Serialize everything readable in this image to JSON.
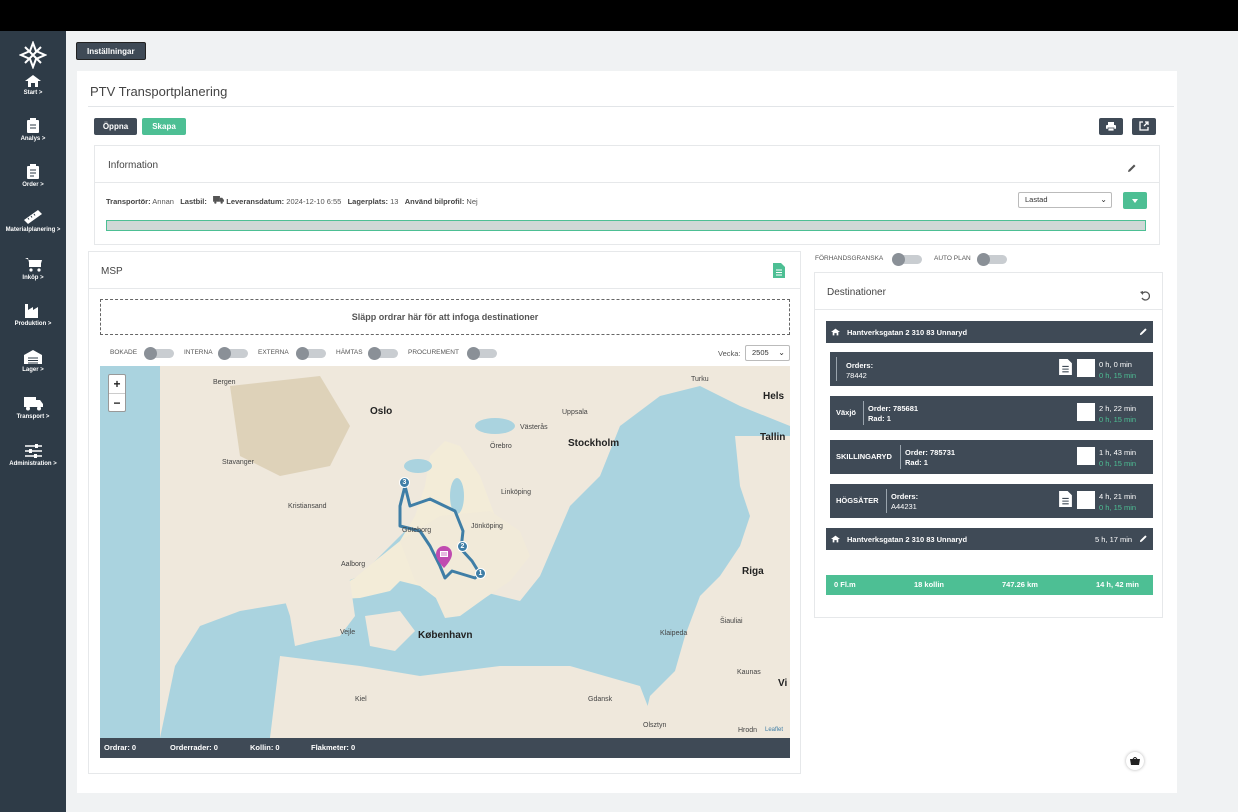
{
  "sidebar": {
    "items": [
      {
        "label": "Start >",
        "icon": "home-icon"
      },
      {
        "label": "Analys >",
        "icon": "clipboard-icon"
      },
      {
        "label": "Order >",
        "icon": "clipboard-list-icon"
      },
      {
        "label": "Materialplanering >",
        "icon": "ruler-icon"
      },
      {
        "label": "Inköp >",
        "icon": "cart-icon"
      },
      {
        "label": "Produktion >",
        "icon": "factory-icon"
      },
      {
        "label": "Lager >",
        "icon": "warehouse-icon"
      },
      {
        "label": "Transport >",
        "icon": "truck-icon"
      },
      {
        "label": "Administration >",
        "icon": "sliders-icon"
      }
    ]
  },
  "header": {
    "settings_label": "Inställningar"
  },
  "page": {
    "title": "PTV Transportplanering"
  },
  "toolbar": {
    "open_label": "Öppna",
    "create_label": "Skapa"
  },
  "info": {
    "title": "Information",
    "carrier_label": "Transportör:",
    "carrier_value": "Annan",
    "truck_label": "Lastbil:",
    "delivery_label": "Leveransdatum:",
    "delivery_value": "2024-12-10 6:55",
    "storage_label": "Lagerplats:",
    "storage_value": "13",
    "profile_label": "Använd bilprofil:",
    "profile_value": "Nej",
    "status_value": "Lastad"
  },
  "msp": {
    "title": "MSP",
    "drop_text": "Släpp ordrar här för att infoga destinationer",
    "filters": [
      "BOKADE",
      "INTERNA",
      "EXTERNA",
      "HÄMTAS",
      "PROCUREMENT"
    ],
    "week_label": "Vecka:",
    "week_value": "2505",
    "zoom_in": "+",
    "zoom_out": "−",
    "attribution": "Leaflet",
    "footer": {
      "orders": "Ordrar: 0",
      "orderlines": "Orderrader: 0",
      "packages": "Kollin: 0",
      "flakmeter": "Flakmeter: 0"
    }
  },
  "map": {
    "cities": [
      {
        "name": "Bergen",
        "size": "small"
      },
      {
        "name": "Oslo",
        "size": "big"
      },
      {
        "name": "Uppsala",
        "size": "small"
      },
      {
        "name": "Turku",
        "size": "small"
      },
      {
        "name": "Hels",
        "size": "big"
      },
      {
        "name": "Västerås",
        "size": "small"
      },
      {
        "name": "Stockholm",
        "size": "big"
      },
      {
        "name": "Örebro",
        "size": "small"
      },
      {
        "name": "Tallin",
        "size": "big"
      },
      {
        "name": "Stavanger",
        "size": "small"
      },
      {
        "name": "Linköping",
        "size": "small"
      },
      {
        "name": "Kristiansand",
        "size": "small"
      },
      {
        "name": "Jönköping",
        "size": "small"
      },
      {
        "name": "Göteborg",
        "size": "small"
      },
      {
        "name": "Aalborg",
        "size": "small"
      },
      {
        "name": "Riga",
        "size": "big"
      },
      {
        "name": "Šiauliai",
        "size": "small"
      },
      {
        "name": "Vejle",
        "size": "small"
      },
      {
        "name": "København",
        "size": "big"
      },
      {
        "name": "Klaipeda",
        "size": "small"
      },
      {
        "name": "Kaunas",
        "size": "small"
      },
      {
        "name": "Vi",
        "size": "big"
      },
      {
        "name": "Kiel",
        "size": "small"
      },
      {
        "name": "Gdansk",
        "size": "small"
      },
      {
        "name": "Olsztyn",
        "size": "small"
      },
      {
        "name": "Hrodn",
        "size": "small"
      }
    ],
    "route_markers": [
      "1",
      "2",
      "3"
    ]
  },
  "toggles": {
    "preview": "FÖRHANDSGRANSKA",
    "autoplan": "AUTO PLAN"
  },
  "destinations": {
    "title": "Destinationer",
    "start_address": "Hantverksgatan 2 310 83 Unnaryd",
    "end_address": "Hantverksgatan 2 310 83 Unnaryd",
    "end_time": "5 h, 17 min",
    "stops": [
      {
        "name": "",
        "order_label": "Orders:",
        "order_value": "78442",
        "drive": "0 h, 0 min",
        "stop": "0 h, 15 min",
        "has_doc": true
      },
      {
        "name": "Växjö",
        "order_label": "Order: 785681",
        "order_value": "Rad: 1",
        "drive": "2 h, 22 min",
        "stop": "0 h, 15 min",
        "has_doc": false
      },
      {
        "name": "SKILLINGARYD",
        "order_label": "Order: 785731",
        "order_value": "Rad: 1",
        "drive": "1 h, 43 min",
        "stop": "0 h, 15 min",
        "has_doc": false
      },
      {
        "name": "HÖGSÄTER",
        "order_label": "Orders:",
        "order_value": "A44231",
        "drive": "4 h, 21 min",
        "stop": "0 h, 15 min",
        "has_doc": true
      }
    ],
    "summary": {
      "flm": "0 Fl.m",
      "packages": "18 kollin",
      "distance": "747.26 km",
      "time": "14 h, 42 min"
    }
  },
  "colors": {
    "sidebar": "#2e3b47",
    "dark": "#3f4a56",
    "accent": "#4dbf94",
    "route": "#3f7ea6",
    "marker": "#c04bb0"
  }
}
